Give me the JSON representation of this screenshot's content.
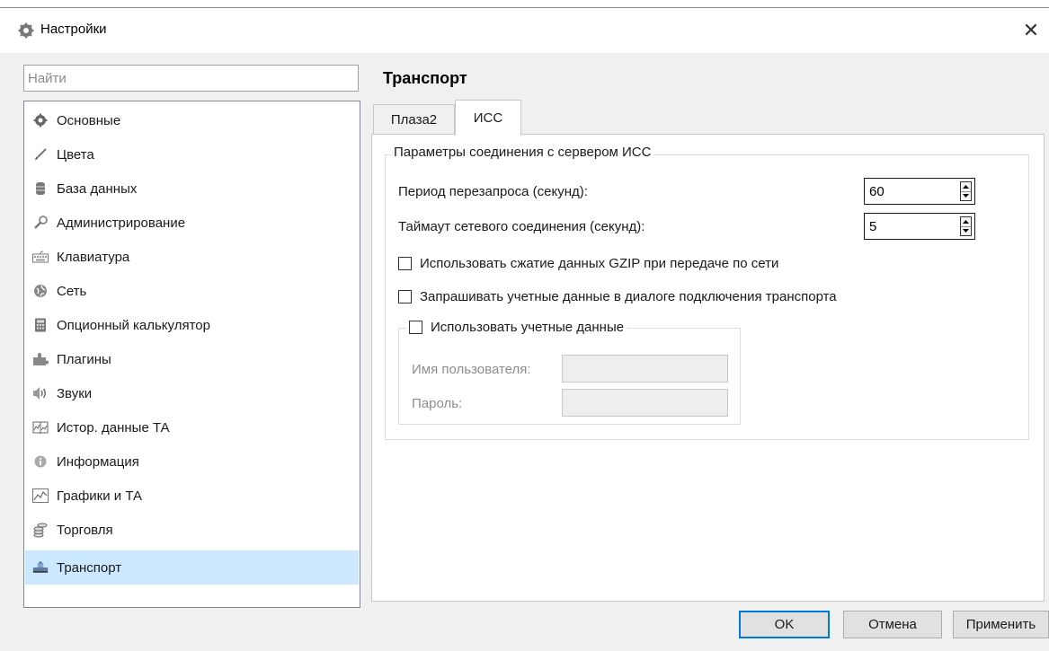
{
  "window": {
    "title": "Настройки",
    "close_symbol": "✕",
    "title_icon": "gear-icon"
  },
  "search": {
    "placeholder": "Найти",
    "value": ""
  },
  "nav": {
    "items": [
      {
        "label": "Основные",
        "icon": "gear-icon"
      },
      {
        "label": "Цвета",
        "icon": "brush-icon"
      },
      {
        "label": "База данных",
        "icon": "database-icon"
      },
      {
        "label": "Администрирование",
        "icon": "wrench-icon"
      },
      {
        "label": "Клавиатура",
        "icon": "keyboard-icon"
      },
      {
        "label": "Сеть",
        "icon": "network-icon"
      },
      {
        "label": "Опционный калькулятор",
        "icon": "calculator-icon"
      },
      {
        "label": "Плагины",
        "icon": "puzzle-icon"
      },
      {
        "label": "Звуки",
        "icon": "speaker-icon"
      },
      {
        "label": "Истор. данные ТА",
        "icon": "book-icon"
      },
      {
        "label": "Информация",
        "icon": "info-icon"
      },
      {
        "label": "Графики и ТА",
        "icon": "chart-icon"
      },
      {
        "label": "Торговля",
        "icon": "coins-icon"
      },
      {
        "label": "Транспорт",
        "icon": "transport-icon"
      }
    ],
    "selected_index": 13
  },
  "content": {
    "section_title": "Транспорт",
    "tabs": [
      {
        "label": "Плаза2",
        "active": false
      },
      {
        "label": "ИСС",
        "active": true
      }
    ],
    "connection_group": {
      "legend": "Параметры соединения с сервером ИСС",
      "retry_period": {
        "label": "Период перезапроса (секунд):",
        "value": "60"
      },
      "network_timeout": {
        "label": "Таймаут сетевого соединения (секунд):",
        "value": "5"
      },
      "gzip": {
        "label": "Использовать сжатие данных GZIP при передаче по сети",
        "checked": false
      },
      "ask_credentials": {
        "label": "Запрашивать учетные данные в диалоге подключения транспорта",
        "checked": false
      },
      "credentials_group": {
        "legend": "Использовать учетные данные",
        "checked": false,
        "username_label": "Имя пользователя:",
        "username_value": "",
        "password_label": "Пароль:",
        "password_value": ""
      }
    }
  },
  "footer": {
    "ok_label": "OK",
    "cancel_label": "Отмена",
    "apply_label": "Применить"
  },
  "colors": {
    "selection": "#cce8ff",
    "focus_border": "#0078d7",
    "window_bg": "#f0f0f0"
  }
}
